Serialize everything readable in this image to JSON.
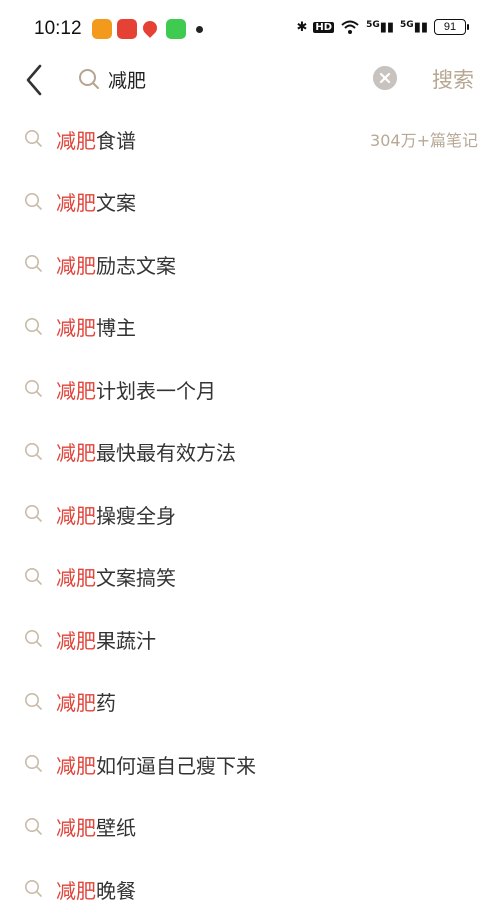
{
  "status_bar": {
    "time": "10:12",
    "battery": "91",
    "network_1": "5G",
    "network_2": "5G",
    "hd_label": "HD"
  },
  "search": {
    "query": "减肥",
    "search_button": "搜索"
  },
  "suggestions": [
    {
      "highlight": "减肥",
      "rest": "食谱",
      "meta": "304万+篇笔记"
    },
    {
      "highlight": "减肥",
      "rest": "文案",
      "meta": ""
    },
    {
      "highlight": "减肥",
      "rest": "励志文案",
      "meta": ""
    },
    {
      "highlight": "减肥",
      "rest": "博主",
      "meta": ""
    },
    {
      "highlight": "减肥",
      "rest": "计划表一个月",
      "meta": ""
    },
    {
      "highlight": "减肥",
      "rest": "最快最有效方法",
      "meta": ""
    },
    {
      "highlight": "减肥",
      "rest": "操瘦全身",
      "meta": ""
    },
    {
      "highlight": "减肥",
      "rest": "文案搞笑",
      "meta": ""
    },
    {
      "highlight": "减肥",
      "rest": "果蔬汁",
      "meta": ""
    },
    {
      "highlight": "减肥",
      "rest": "药",
      "meta": ""
    },
    {
      "highlight": "减肥",
      "rest": "如何逼自己瘦下来",
      "meta": ""
    },
    {
      "highlight": "减肥",
      "rest": "壁纸",
      "meta": ""
    },
    {
      "highlight": "减肥",
      "rest": "晚餐",
      "meta": ""
    }
  ],
  "colors": {
    "highlight": "#e0443a",
    "accent": "#b7a692"
  }
}
